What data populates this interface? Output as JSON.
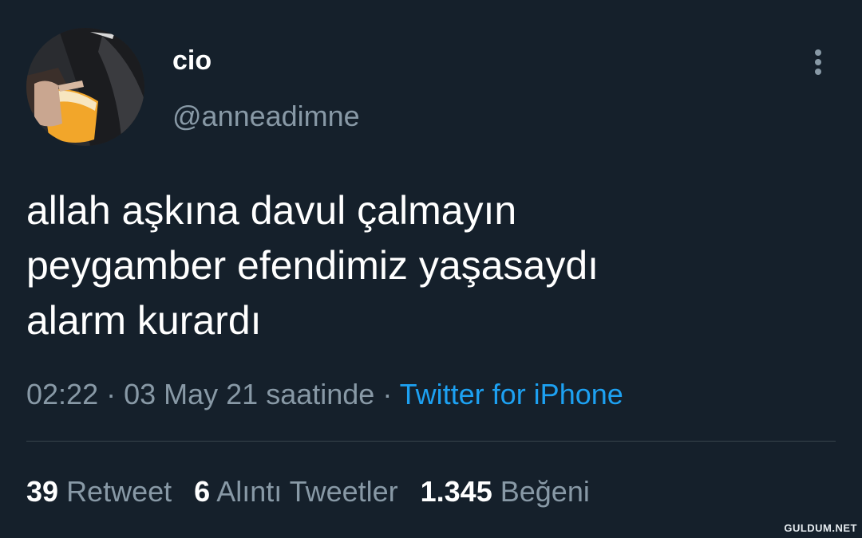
{
  "tweet": {
    "author": {
      "display_name": "cio",
      "handle": "@anneadimne",
      "avatar_icon": "profile-photo"
    },
    "more_icon": "more-vertical-icon",
    "text_lines": [
      "allah aşkına davul çalmayın",
      "peygamber efendimiz yaşasaydı",
      "alarm kurardı"
    ],
    "meta": {
      "time": "02:22",
      "separator": " · ",
      "date_text": "03 May 21 saatinde",
      "source": "Twitter for iPhone"
    },
    "stats": {
      "retweets": {
        "count": "39",
        "label": "Retweet"
      },
      "quotes": {
        "count": "6",
        "label": "Alıntı Tweetler"
      },
      "likes": {
        "count": "1.345",
        "label": "Beğeni"
      }
    }
  },
  "watermark": "GULDUM.NET",
  "colors": {
    "background": "#15202b",
    "primary_text": "#ffffff",
    "secondary_text": "#8899a6",
    "link": "#1da1f2",
    "divider": "#38444d"
  }
}
